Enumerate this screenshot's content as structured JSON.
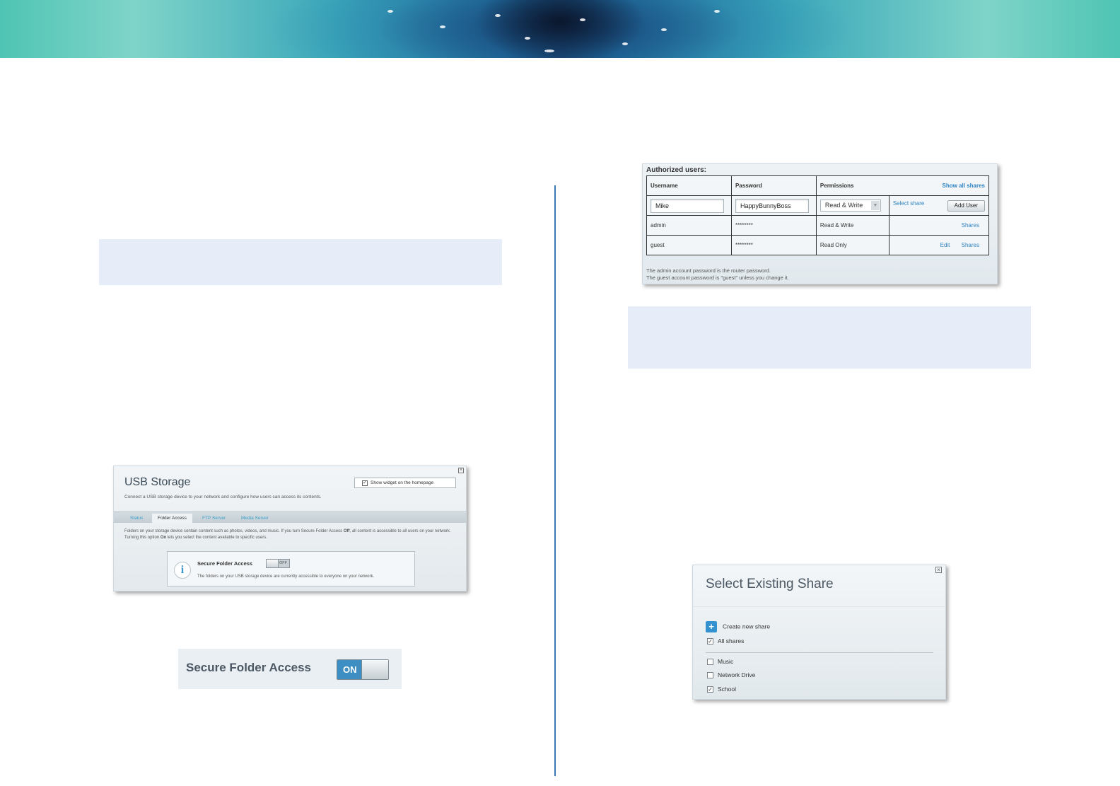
{
  "authorized_users": {
    "title": "Authorized users:",
    "headers": {
      "username": "Username",
      "password": "Password",
      "permissions": "Permissions",
      "show_all": "Show all shares"
    },
    "new_user": {
      "username": "Mike",
      "password": "HappyBunnyBoss",
      "permission": "Read & Write",
      "select_share": "Select share",
      "add_user": "Add User"
    },
    "rows": [
      {
        "username": "admin",
        "password": "********",
        "permission": "Read & Write",
        "edit": "",
        "shares": "Shares"
      },
      {
        "username": "guest",
        "password": "********",
        "permission": "Read Only",
        "edit": "Edit",
        "shares": "Shares"
      }
    ],
    "note_line1": "The admin account password is the router password.",
    "note_line2": "The guest account password is \"guest\" unless you change it."
  },
  "usb_storage": {
    "title": "USB Storage",
    "description": "Connect a USB storage device to your network and configure how users can access its contents.",
    "show_widget": "Show widget on the homepage",
    "show_widget_checked": true,
    "tabs": [
      "Status",
      "Folder Access",
      "FTP Server",
      "Media Server"
    ],
    "active_tab": "Folder Access",
    "body_text_1": "Folders on your storage device contain content such as photos, videos, and music. If you turn Secure Folder Access ",
    "body_bold_off": "Off",
    "body_text_2": ", all content is accessible to all users on your network. Turning this option ",
    "body_bold_on": "On",
    "body_text_3": " lets you select the content available to specific users.",
    "secure_folder_access_label": "Secure Folder Access",
    "toggle_state": "OFF",
    "status_text": "The folders on your USB storage device are currently accessible to everyone on your network."
  },
  "secure_folder_access_toggle": {
    "label": "Secure Folder Access",
    "state": "ON"
  },
  "select_existing_share": {
    "title": "Select Existing Share",
    "create_new": "Create new share",
    "all_shares": "All shares",
    "all_shares_checked": true,
    "shares": [
      {
        "name": "Music",
        "checked": false
      },
      {
        "name": "Network Drive",
        "checked": false
      },
      {
        "name": "School",
        "checked": true
      }
    ]
  },
  "colors": {
    "accent": "#3592d0",
    "link": "#2f84c2",
    "info_box": "#e6edf9",
    "divider": "#3b79b4"
  }
}
